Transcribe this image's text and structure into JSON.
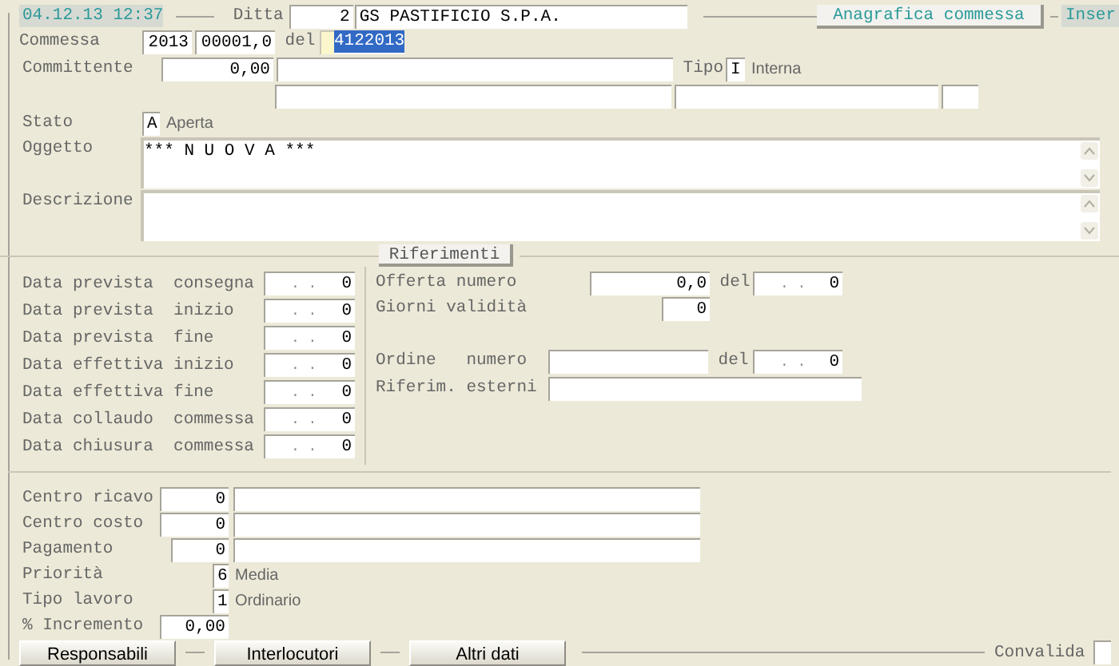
{
  "header": {
    "timestamp": "04.12.13 12:37",
    "ditta_label": "Ditta",
    "ditta_code": "2",
    "ditta_name": "GS PASTIFICIO S.P.A.",
    "anagrafica_button": "Anagrafica commessa",
    "mode": "Inser"
  },
  "commessa": {
    "label": "Commessa",
    "year": "2013",
    "number": "00001,0",
    "del_label": "del",
    "date": "4122013",
    "date_selected": true
  },
  "committente": {
    "label": "Committente",
    "code": "0,00",
    "tipo_label": "Tipo",
    "tipo_code": "I",
    "tipo_desc": "Interna"
  },
  "stato": {
    "label": "Stato",
    "code": "A",
    "desc": "Aperta"
  },
  "oggetto": {
    "label": "Oggetto",
    "value": "*** N U O V A ***"
  },
  "descrizione": {
    "label": "Descrizione"
  },
  "riferimenti_tab": "Riferimenti",
  "dates": [
    {
      "label": "Data prevista  consegna",
      "mask": ". .",
      "value": "0"
    },
    {
      "label": "Data prevista  inizio",
      "mask": ". .",
      "value": "0"
    },
    {
      "label": "Data prevista  fine",
      "mask": ". .",
      "value": "0"
    },
    {
      "label": "Data effettiva inizio",
      "mask": ". .",
      "value": "0"
    },
    {
      "label": "Data effettiva fine",
      "mask": ". .",
      "value": "0"
    },
    {
      "label": "Data collaudo  commessa",
      "mask": ". .",
      "value": "0"
    },
    {
      "label": "Data chiusura  commessa",
      "mask": ". .",
      "value": "0"
    }
  ],
  "riferimenti": {
    "offerta_label": "Offerta numero",
    "offerta_value": "0,0",
    "offerta_del": "del",
    "offerta_date_mask": ". .",
    "offerta_date_value": "0",
    "giorni_label": "Giorni validità",
    "giorni_value": "0",
    "ordine_label": "Ordine   numero",
    "ordine_del": "del",
    "ordine_date_mask": ". .",
    "ordine_date_value": "0",
    "esterni_label": "Riferim. esterni"
  },
  "bottom_rows": [
    {
      "kind": "lookup",
      "label": "Centro ricavo",
      "code": "0"
    },
    {
      "kind": "lookup",
      "label": "Centro costo",
      "code": "0"
    },
    {
      "kind": "lookup_short",
      "label": "Pagamento",
      "code": "0"
    },
    {
      "kind": "choice",
      "label": "Priorità",
      "code": "6",
      "desc": "Media"
    },
    {
      "kind": "choice",
      "label": "Tipo lavoro",
      "code": "1",
      "desc": "Ordinario"
    },
    {
      "kind": "amount",
      "label": "% Incremento",
      "code": "0,00"
    }
  ],
  "buttons": [
    "Responsabili",
    "Interlocutori",
    "Altri dati"
  ],
  "convalida": {
    "label": "Convalida",
    "checked": false
  }
}
